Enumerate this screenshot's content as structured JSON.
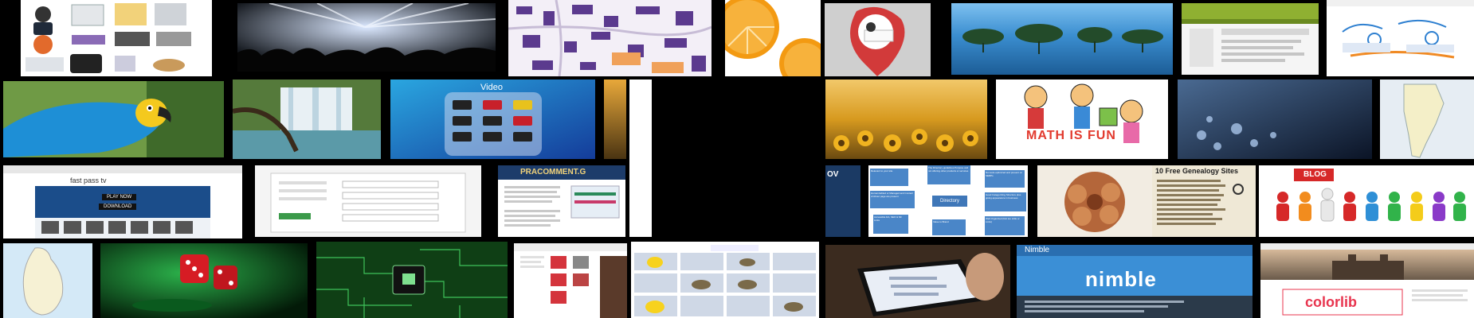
{
  "tiles": {
    "fastpass": {
      "title": "fast pass tv",
      "play_label": "PLAY NOW",
      "download_label": "DOWNLOAD"
    },
    "video": {
      "title": "Video"
    },
    "pra": {
      "title": "PRACOMMENT.G"
    },
    "ovstrip": {
      "text": "OV"
    },
    "directory": {
      "center": "Directory",
      "nodes": [
        "Relevant to your site",
        "The Directory guidelines Purpose and not offering other products or services",
        "Not auto-optimized and present on SERPs",
        "Human Edited or Managed and Contact of About page are present",
        "Good Categorizing Structure plus giving appearance in business",
        "Accessible DA, SEO & NF Links",
        "Value to Brand",
        "Well Organized (Not too Little or Links)"
      ]
    },
    "math": {
      "title": "MATH IS FUN"
    },
    "genealogy": {
      "title": "10 Free Genealogy Sites"
    },
    "blog": {
      "sign": "BLOG"
    },
    "nimble": {
      "header": "Nimble",
      "logo": "nimble"
    },
    "colorlib": {
      "logo": "colorlib"
    }
  },
  "colors": {
    "background": "#000000",
    "concert_light": "#dbe8ff",
    "orange": "#f39a12",
    "lake": "#2f7fc4",
    "nimble": "#3b8fd6",
    "colorlib": "#e8344e"
  },
  "icons": [
    "office-icons",
    "concert-photo",
    "campus-map",
    "orange-slice",
    "map-pin",
    "mangrove-lake",
    "green-website",
    "sketch",
    "parrot",
    "waterfall",
    "video-apps",
    "sunflowers",
    "frost-flowers",
    "argentina-map",
    "flower",
    "blog-people",
    "sri-lanka-map",
    "dice",
    "circuit-board",
    "rubber-ducks",
    "tablet",
    "notre-dame"
  ]
}
